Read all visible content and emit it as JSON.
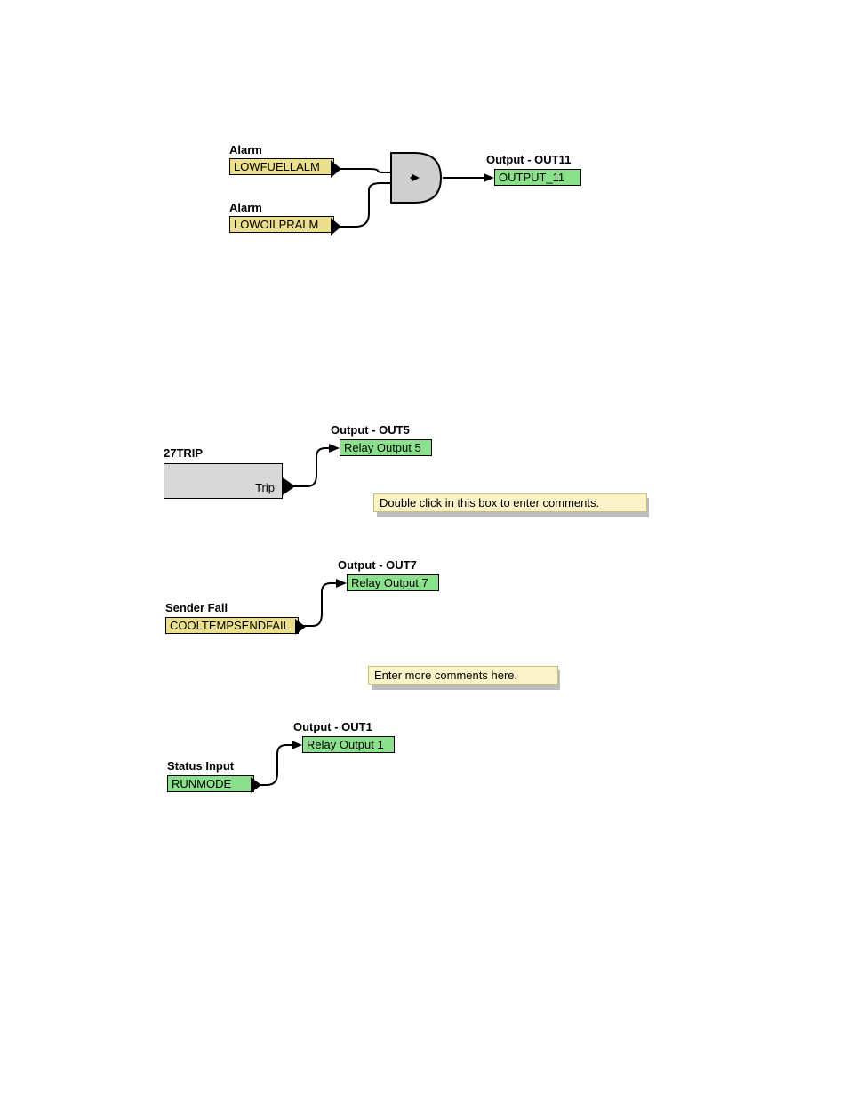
{
  "diagram1": {
    "alarm1_title": "Alarm",
    "alarm1_name": "LOWFUELLALM",
    "alarm2_title": "Alarm",
    "alarm2_name": "LOWOILPRALM",
    "output_title": "Output - OUT11",
    "output_name": "OUTPUT_11"
  },
  "diagram2": {
    "block_title": "27TRIP",
    "block_port": "Trip",
    "output_title": "Output - OUT5",
    "output_name": "Relay Output 5",
    "comment": "Double click in this box to enter comments."
  },
  "diagram3": {
    "input_title": "Sender Fail",
    "input_name": "COOLTEMPSENDFAIL",
    "output_title": "Output - OUT7",
    "output_name": "Relay Output 7",
    "comment": "Enter more comments here."
  },
  "diagram4": {
    "input_title": "Status Input",
    "input_name": "RUNMODE",
    "output_title": "Output - OUT1",
    "output_name": "Relay Output 1"
  }
}
